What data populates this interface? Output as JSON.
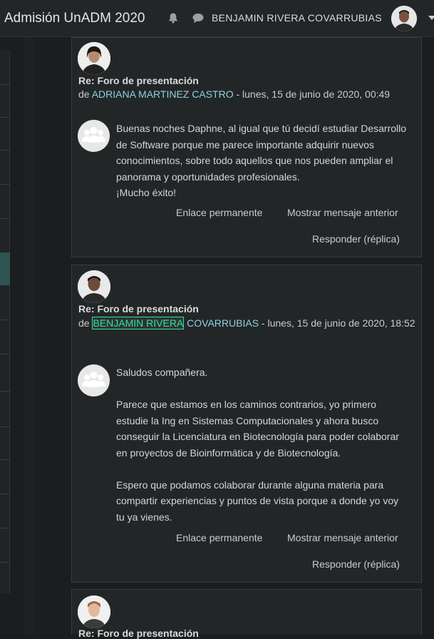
{
  "header": {
    "site_title": "Admisión UnADM 2020",
    "user_name": "BENJAMIN RIVERA COVARRUBIAS"
  },
  "posts": [
    {
      "subject": "Re: Foro de presentación",
      "by_prefix": "de ",
      "author": "ADRIANA MARTINEZ CASTRO",
      "date": " - lunes, 15 de junio de 2020, 00:49",
      "message": [
        "Buenas noches Daphne, al igual que tú decidí estudiar Desarrollo de Software porque me parece importante adquirir nuevos conocimientos, sobre todo aquellos que nos pueden ampliar el panorama y oportunidades profesionales.",
        "¡Mucho éxito!"
      ],
      "permalink": "Enlace permanente",
      "show_parent": "Mostrar mensaje anterior",
      "reply": "Responder (réplica)"
    },
    {
      "subject": "Re: Foro de presentación",
      "by_prefix": "de ",
      "author_highlight": "BENJAMIN RIVERA",
      "author_rest": " COVARRUBIAS",
      "date": " - lunes, 15 de junio de 2020, 18:52",
      "message": [
        "Saludos compañera.",
        "Parece que estamos en los caminos contrarios, yo primero estudie la Ing en Sistemas Computacionales y ahora busco conseguir la Licenciatura en Biotecnología para poder colaborar en proyectos de Bioinformática y de Biotecnología.",
        "Espero que podamos colaborar durante alguna materia para compartir experiencias y puntos de vista porque a donde yo voy tu ya vienes."
      ],
      "permalink": "Enlace permanente",
      "show_parent": "Mostrar mensaje anterior",
      "reply": "Responder (réplica)"
    },
    {
      "subject": "Re: Foro de presentación"
    }
  ],
  "colors": {
    "background": "#1b1d1f",
    "post_bg": "#232627",
    "author_link": "#8fd0e3",
    "search_highlight": "#2ee59d"
  },
  "icons": [
    "bell-icon",
    "chat-icon",
    "group-picture-icon"
  ]
}
